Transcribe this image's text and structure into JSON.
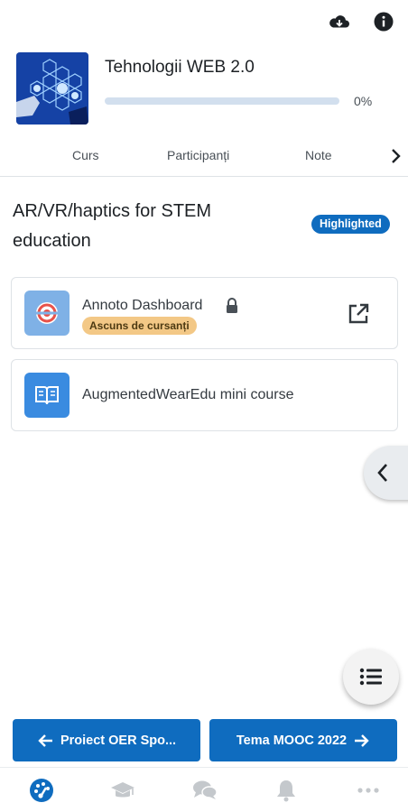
{
  "course": {
    "title": "Tehnologii WEB 2.0",
    "progress_label": "0%",
    "progress_fraction": 0
  },
  "tabs": {
    "items": [
      {
        "label": "Curs"
      },
      {
        "label": "Participanți"
      },
      {
        "label": "Note"
      }
    ]
  },
  "section": {
    "title": "AR/VR/haptics for STEM education",
    "badge": "Highlighted"
  },
  "modules": [
    {
      "name": "Annoto Dashboard",
      "badge": "Ascuns de cursanți",
      "icon": "annoto-icon"
    },
    {
      "name": "AugmentedWearEdu mini course",
      "icon": "book-icon"
    }
  ],
  "navigation": {
    "prev_label": "Proiect OER Spo...",
    "next_label": "Tema MOOC 2022"
  },
  "bottom_tabs": [
    {
      "icon": "dashboard-icon"
    },
    {
      "icon": "graduation-cap-icon"
    },
    {
      "icon": "chat-icon"
    },
    {
      "icon": "bell-icon"
    },
    {
      "icon": "more-icon"
    }
  ],
  "colors": {
    "brand": "#0f6cbf",
    "hidden_badge": "#f3c886",
    "progress_track": "#d2dfee"
  }
}
